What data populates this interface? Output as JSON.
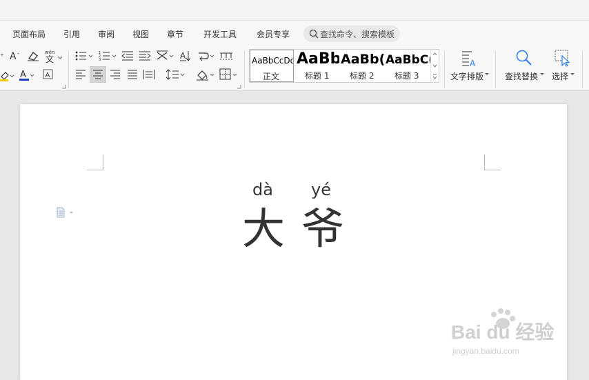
{
  "menu": {
    "items": [
      {
        "label": "页面布局"
      },
      {
        "label": "引用"
      },
      {
        "label": "审阅"
      },
      {
        "label": "视图"
      },
      {
        "label": "章节"
      },
      {
        "label": "开发工具"
      },
      {
        "label": "会员专享"
      }
    ],
    "search_placeholder": "查找命令、搜索模板"
  },
  "ribbon": {
    "pinyin_glyph": "wén",
    "styles": [
      {
        "sample": "AaBbCcDd",
        "name": "正文",
        "selected": true
      },
      {
        "sample": "AaBb",
        "name": "标题 1"
      },
      {
        "sample": "AaBb(",
        "name": "标题 2"
      },
      {
        "sample": "AaBbC(",
        "name": "标题 3"
      }
    ],
    "text_layout_label": "文字排版",
    "find_replace_label": "查找替换",
    "select_label": "选择"
  },
  "document": {
    "chars": [
      {
        "pinyin": "dà",
        "hanzi": "大"
      },
      {
        "pinyin": "yé",
        "hanzi": "爷"
      }
    ]
  },
  "watermark": {
    "main": "Bai du 经验",
    "sub": "jingyan.baidu.com"
  },
  "colors": {
    "accent": "#2d7be5",
    "highlight_yellow": "#f5d000",
    "font_color_red": "#d0021b",
    "font_color_blue": "#1f3fbf",
    "selected_align_bg": "#d6d6d6"
  }
}
